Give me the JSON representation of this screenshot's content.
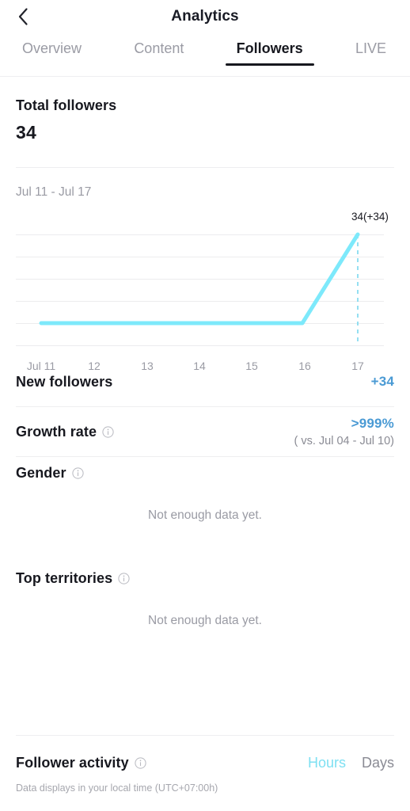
{
  "header": {
    "title": "Analytics",
    "back_icon": "chevron-left-icon"
  },
  "tabs": [
    {
      "label": "Overview",
      "active": false
    },
    {
      "label": "Content",
      "active": false
    },
    {
      "label": "Followers",
      "active": true
    },
    {
      "label": "LIVE",
      "active": false
    }
  ],
  "total_followers": {
    "label": "Total followers",
    "value": "34"
  },
  "date_range": "Jul 11 - Jul 17",
  "chart_data": {
    "type": "line",
    "title": "",
    "xlabel": "",
    "ylabel": "",
    "categories": [
      "Jul 11",
      "12",
      "13",
      "14",
      "15",
      "16",
      "17"
    ],
    "x_tick_labels": [
      "Jul 11",
      "12",
      "13",
      "14",
      "15",
      "16",
      "17"
    ],
    "series": [
      {
        "name": "Total followers",
        "values": [
          0,
          0,
          0,
          0,
          0,
          0,
          34
        ]
      }
    ],
    "ylim": [
      0,
      40
    ],
    "grid": true,
    "gridlines": 6,
    "legend": "none",
    "point_label": "34(+34)",
    "highlight_index": 6,
    "line_color": "#7de9fb",
    "grid_color": "#ececee",
    "tick_color": "#9a9ba4",
    "marker_line": "dashed-vertical"
  },
  "metrics": [
    {
      "label": "New followers",
      "value": "+34",
      "sub": "",
      "has_info": false,
      "info_icon": "info-icon"
    },
    {
      "label": "Growth rate",
      "value": ">999%",
      "sub": "( vs. Jul 04 - Jul 10)",
      "has_info": true,
      "info_icon": "info-icon"
    }
  ],
  "gender": {
    "label": "Gender",
    "info_icon": "info-icon",
    "empty": "Not enough data yet."
  },
  "territories": {
    "label": "Top territories",
    "info_icon": "info-icon",
    "empty": "Not enough data yet."
  },
  "follower_activity": {
    "label": "Follower activity",
    "info_icon": "info-icon",
    "toggles": [
      {
        "label": "Hours",
        "active": true
      },
      {
        "label": "Days",
        "active": false
      }
    ],
    "note": "Data displays in your local time (UTC+07:00h)"
  },
  "colors": {
    "accent_cyan": "#7de9fb",
    "accent_blue": "#4a9ad4",
    "text_dark": "#17181f",
    "text_muted": "#9a9ba4",
    "divider": "#eeeef0"
  }
}
